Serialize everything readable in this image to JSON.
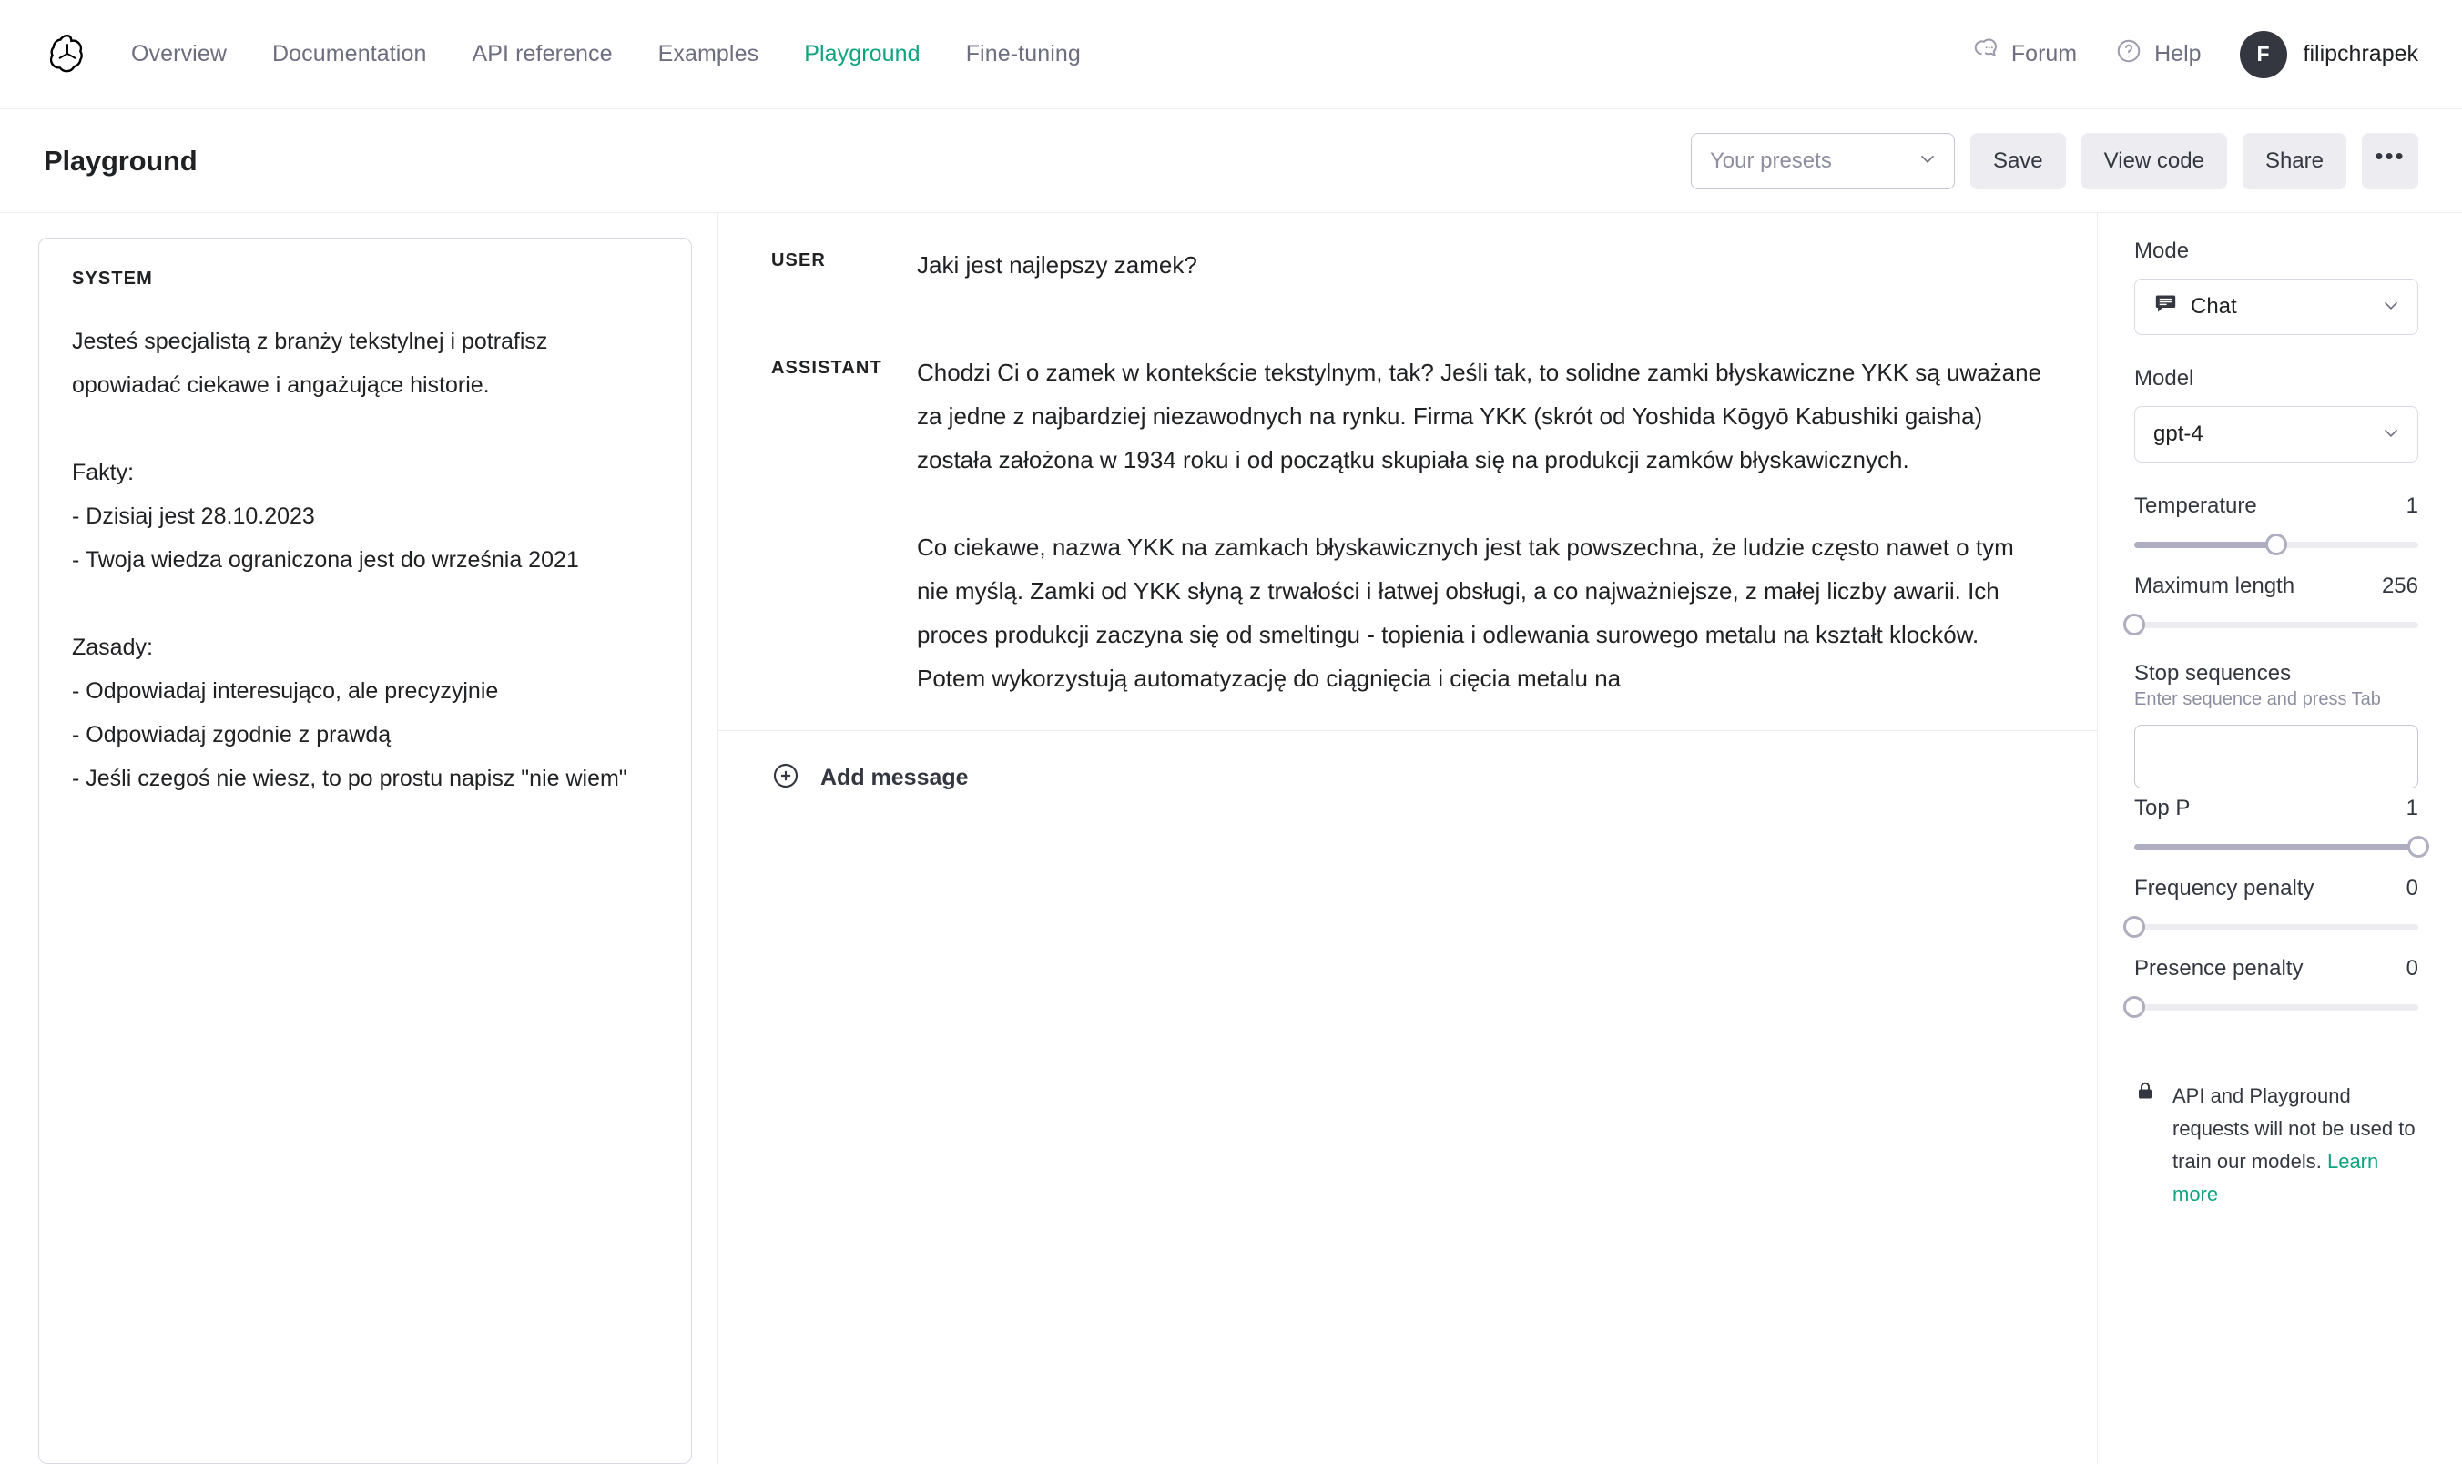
{
  "nav": {
    "logo_icon": "openai-logo-icon",
    "links": [
      {
        "label": "Overview",
        "active": false
      },
      {
        "label": "Documentation",
        "active": false
      },
      {
        "label": "API reference",
        "active": false
      },
      {
        "label": "Examples",
        "active": false
      },
      {
        "label": "Playground",
        "active": true
      },
      {
        "label": "Fine-tuning",
        "active": false
      }
    ],
    "forum_label": "Forum",
    "help_label": "Help",
    "avatar_initial": "F",
    "user_name": "filipchrapek",
    "active_color": "#10a37f"
  },
  "subheader": {
    "title": "Playground",
    "presets_placeholder": "Your presets",
    "save_label": "Save",
    "view_code_label": "View code",
    "share_label": "Share",
    "more_label": "•••"
  },
  "system": {
    "label": "SYSTEM",
    "text": "Jesteś specjalistą z branży tekstylnej i potrafisz opowiadać ciekawe i angażujące historie.\n\nFakty:\n- Dzisiaj jest 28.10.2023\n- Twoja wiedza ograniczona jest do września 2021\n\nZasady:\n- Odpowiadaj interesująco, ale precyzyjnie\n- Odpowiadaj zgodnie z prawdą\n- Jeśli czegoś nie wiesz, to po prostu napisz \"nie wiem\""
  },
  "messages": [
    {
      "role": "USER",
      "paragraphs": [
        "Jaki jest najlepszy zamek?"
      ]
    },
    {
      "role": "ASSISTANT",
      "paragraphs": [
        "Chodzi Ci o zamek w kontekście tekstylnym, tak? Jeśli tak, to solidne zamki błyskawiczne YKK są uważane za jedne z najbardziej niezawodnych na rynku. Firma YKK (skrót od Yoshida Kōgyō Kabushiki gaisha) została założona w 1934 roku i od początku skupiała się na produkcji zamków błyskawicznych.",
        "Co ciekawe, nazwa YKK na zamkach błyskawicznych jest tak powszechna, że ludzie często nawet o tym nie myślą. Zamki od YKK słyną z trwałości i łatwej obsługi, a co najważniejsze, z małej liczby awarii. Ich proces produkcji zaczyna się od smeltingu - topienia i odlewania surowego metalu na kształt klocków. Potem wykorzystują automatyzację do ciągnięcia i cięcia metalu na"
      ]
    }
  ],
  "add_message_label": "Add message",
  "sidebar": {
    "mode_label": "Mode",
    "mode_value": "Chat",
    "mode_icon": "chat-bubble-icon",
    "model_label": "Model",
    "model_value": "gpt-4",
    "params": [
      {
        "name": "Temperature",
        "value": "1",
        "percent": 50
      },
      {
        "name": "Maximum length",
        "value": "256",
        "percent": 0
      },
      {
        "name": "Top P",
        "value": "1",
        "percent": 100
      },
      {
        "name": "Frequency penalty",
        "value": "0",
        "percent": 0
      },
      {
        "name": "Presence penalty",
        "value": "0",
        "percent": 0
      }
    ],
    "stop_sequences": {
      "title": "Stop sequences",
      "subtitle": "Enter sequence and press Tab",
      "value": "",
      "placeholder": ""
    },
    "privacy": {
      "icon": "lock-icon",
      "text": "API and Playground requests will not be used to train our models. ",
      "link_label": "Learn more"
    }
  }
}
